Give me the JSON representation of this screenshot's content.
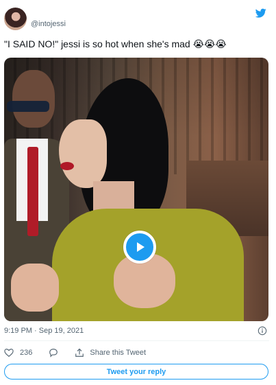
{
  "author": {
    "handle": "@intojessi"
  },
  "tweet": {
    "text": "\"I SAID NO!\" jessi is so hot when she's mad 😭😭😭"
  },
  "meta": {
    "timestamp": "9:19 PM · Sep 19, 2021"
  },
  "actions": {
    "like_count": "236",
    "share_label": "Share this Tweet"
  },
  "reply_button": {
    "label": "Tweet your reply"
  },
  "colors": {
    "accent": "#1d9bf0",
    "muted": "#536471"
  },
  "icons": [
    "twitter-bird-icon",
    "play-icon",
    "info-icon",
    "heart-icon",
    "reply-icon",
    "share-icon"
  ]
}
